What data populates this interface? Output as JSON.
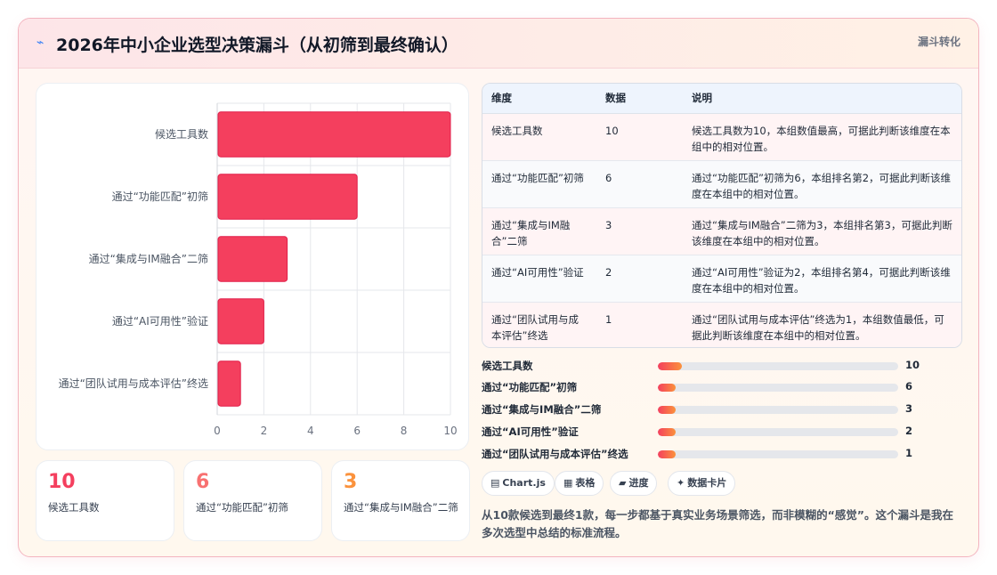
{
  "header": {
    "title_icon": "⌁",
    "title": "2026年中小企业选型决策漏斗（从初筛到最终确认）",
    "badge": "漏斗转化"
  },
  "chart_data": {
    "type": "bar",
    "orientation": "horizontal",
    "categories": [
      "候选工具数",
      "通过“功能匹配”初筛",
      "通过“集成与IM融合”二筛",
      "通过“AI可用性”验证",
      "通过“团队试用与成本评估”终选"
    ],
    "values": [
      10,
      6,
      3,
      2,
      1
    ],
    "xlim": [
      0,
      10
    ],
    "xticks": [
      "0",
      "2",
      "4",
      "6",
      "8",
      "10"
    ],
    "grid": true,
    "bar_color": "#f43f5e",
    "title": "",
    "xlabel": "",
    "ylabel": ""
  },
  "kpis": [
    {
      "value": "10",
      "label": "候选工具数",
      "color": "#f43f5e"
    },
    {
      "value": "6",
      "label": "通过“功能匹配”初筛",
      "color": "#f87171"
    },
    {
      "value": "3",
      "label": "通过“集成与IM融合”二筛",
      "color": "#fb923c"
    }
  ],
  "table": {
    "headers": [
      "维度",
      "数据",
      "说明"
    ],
    "rows": [
      [
        "候选工具数",
        "10",
        "候选工具数为10，本组数值最高，可据此判断该维度在本组中的相对位置。"
      ],
      [
        "通过“功能匹配”初筛",
        "6",
        "通过“功能匹配”初筛为6，本组排名第2，可据此判断该维度在本组中的相对位置。"
      ],
      [
        "通过“集成与IM融合”二筛",
        "3",
        "通过“集成与IM融合”二筛为3，本组排名第3，可据此判断该维度在本组中的相对位置。"
      ],
      [
        "通过“AI可用性”验证",
        "2",
        "通过“AI可用性”验证为2，本组排名第4，可据此判断该维度在本组中的相对位置。"
      ],
      [
        "通过“团队试用与成本评估”终选",
        "1",
        "通过“团队试用与成本评估”终选为1，本组数值最低，可据此判断该维度在本组中的相对位置。"
      ]
    ]
  },
  "progress": [
    {
      "label": "候选工具数",
      "value": "10",
      "fraction": 0.1
    },
    {
      "label": "通过“功能匹配”初筛",
      "value": "6",
      "fraction": 0.075
    },
    {
      "label": "通过“集成与IM融合”二筛",
      "value": "3",
      "fraction": 0.075
    },
    {
      "label": "通过“AI可用性”验证",
      "value": "2",
      "fraction": 0.075
    },
    {
      "label": "通过“团队试用与成本评估”终选",
      "value": "1",
      "fraction": 0.075
    }
  ],
  "pills": [
    {
      "icon": "▤",
      "label": "Chart.js"
    },
    {
      "icon": "▦",
      "label": "表格"
    },
    {
      "icon": "▰",
      "label": "进度"
    },
    {
      "icon": "✦",
      "label": "数据卡片"
    }
  ],
  "note": "从10款候选到最终1款，每一步都基于真实业务场景筛选，而非模糊的“感觉”。这个漏斗是我在多次选型中总结的标准流程。"
}
